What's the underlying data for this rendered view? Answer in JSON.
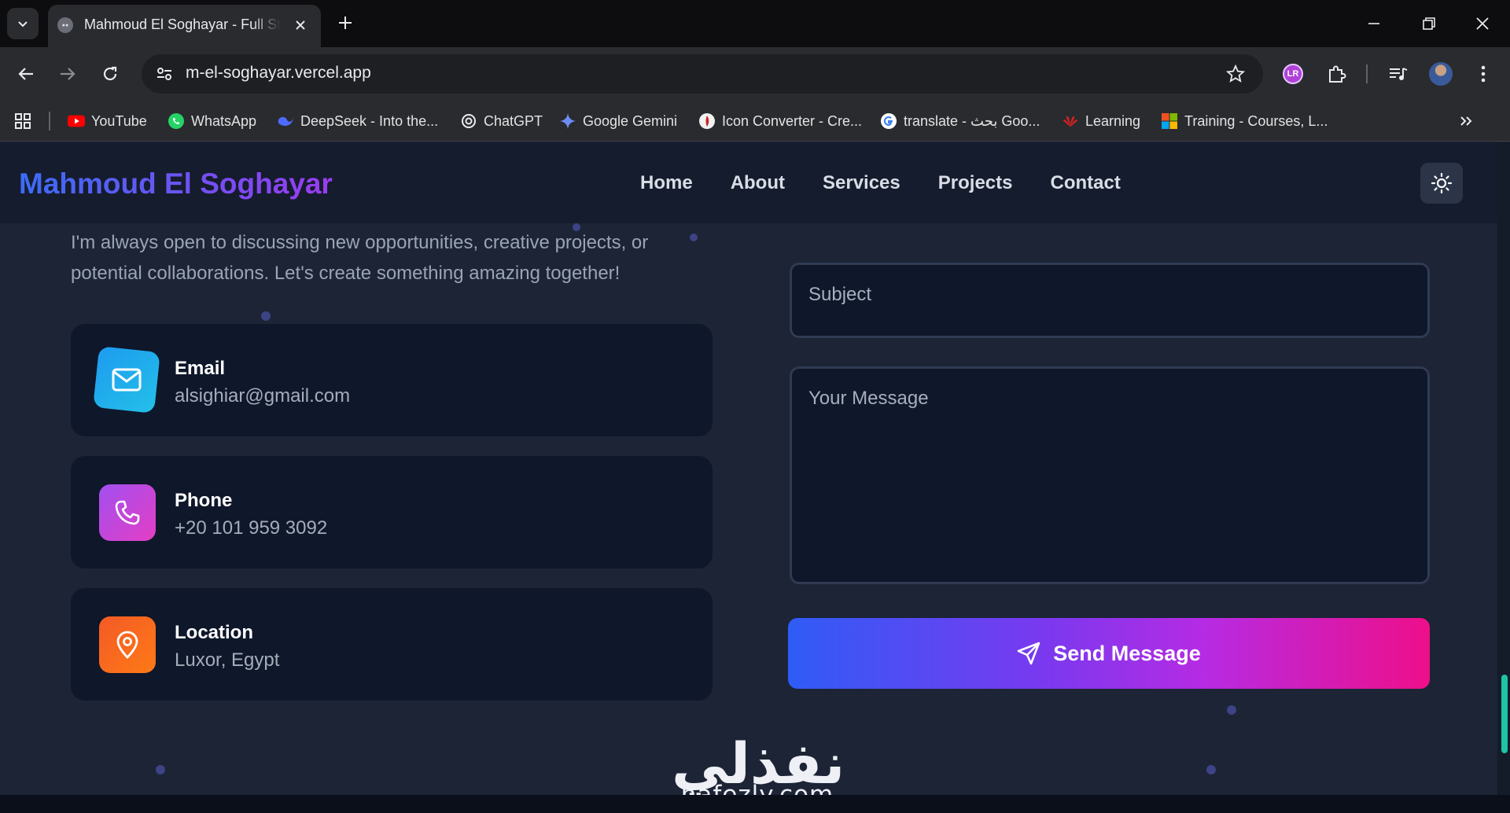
{
  "browser": {
    "tab_title": "Mahmoud El Soghayar - Full Stack",
    "url": "m-el-soghayar.vercel.app",
    "profile_badge": "LR",
    "bookmarks": [
      {
        "label": "YouTube",
        "icon": "youtube-icon"
      },
      {
        "label": "WhatsApp",
        "icon": "whatsapp-icon"
      },
      {
        "label": "DeepSeek - Into the...",
        "icon": "deepseek-icon"
      },
      {
        "label": "ChatGPT",
        "icon": "chatgpt-icon"
      },
      {
        "label": "Google Gemini",
        "icon": "gemini-icon"
      },
      {
        "label": "Icon Converter - Cre...",
        "icon": "icon-converter-icon"
      },
      {
        "label": "translate - بحث Goo...",
        "icon": "google-icon"
      },
      {
        "label": "Learning",
        "icon": "huawei-icon"
      },
      {
        "label": "Training - Courses, L...",
        "icon": "microsoft-icon"
      }
    ]
  },
  "site": {
    "logo": "Mahmoud El Soghayar",
    "nav": [
      "Home",
      "About",
      "Services",
      "Projects",
      "Contact"
    ]
  },
  "contact": {
    "intro": "I'm always open to discussing new opportunities, creative projects, or potential collaborations. Let's create something amazing together!",
    "cards": [
      {
        "title": "Email",
        "value": "alsighiar@gmail.com",
        "icon": "mail-icon",
        "color": "#1fa7f0"
      },
      {
        "title": "Phone",
        "value": "+20 101 959 3092",
        "icon": "phone-icon",
        "color": "#c13fe6"
      },
      {
        "title": "Location",
        "value": "Luxor, Egypt",
        "icon": "location-pin-icon",
        "color": "#fb5a1f"
      }
    ],
    "form": {
      "subject_placeholder": "Subject",
      "message_placeholder": "Your Message",
      "send_label": "Send Message"
    }
  },
  "watermark": {
    "arabic": "نفذلي",
    "latin": "nafezly.com"
  },
  "colors": {
    "accent_blue": "#2f5cf6",
    "accent_pink": "#ee0f8a",
    "card_bg": "#0f172a",
    "page_bg": "#1c2436"
  }
}
